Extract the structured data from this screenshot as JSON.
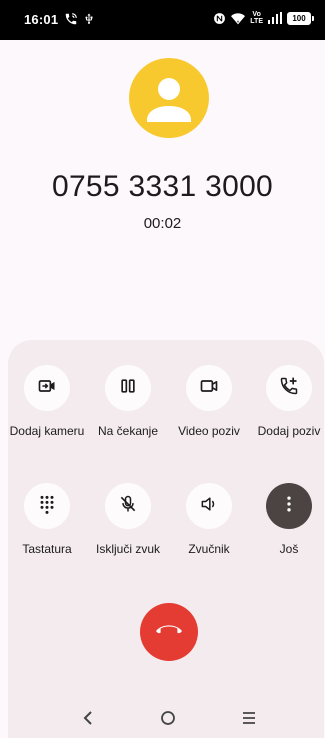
{
  "status_bar": {
    "time": "16:01",
    "volte_top": "Vo",
    "volte_bottom": "LTE",
    "battery": "100"
  },
  "call": {
    "number": "0755 3331 3000",
    "timer": "00:02"
  },
  "actions": [
    {
      "label": "Dodaj kameru",
      "icon": "add-video-icon"
    },
    {
      "label": "Na čekanje",
      "icon": "pause-icon"
    },
    {
      "label": "Video poziv",
      "icon": "video-camera-icon"
    },
    {
      "label": "Dodaj poziv",
      "icon": "add-call-icon"
    },
    {
      "label": "Tastatura",
      "icon": "dialpad-icon"
    },
    {
      "label": "Isključi zvuk",
      "icon": "mic-off-icon"
    },
    {
      "label": "Zvučnik",
      "icon": "speaker-icon"
    },
    {
      "label": "Još",
      "icon": "more-vertical-icon"
    }
  ],
  "colors": {
    "avatar": "#f8c92f",
    "end_call": "#e43b33",
    "panel": "#f3ebed",
    "more_button": "#4c4442"
  },
  "nav_icons": [
    "back-icon",
    "home-icon",
    "recents-icon"
  ]
}
